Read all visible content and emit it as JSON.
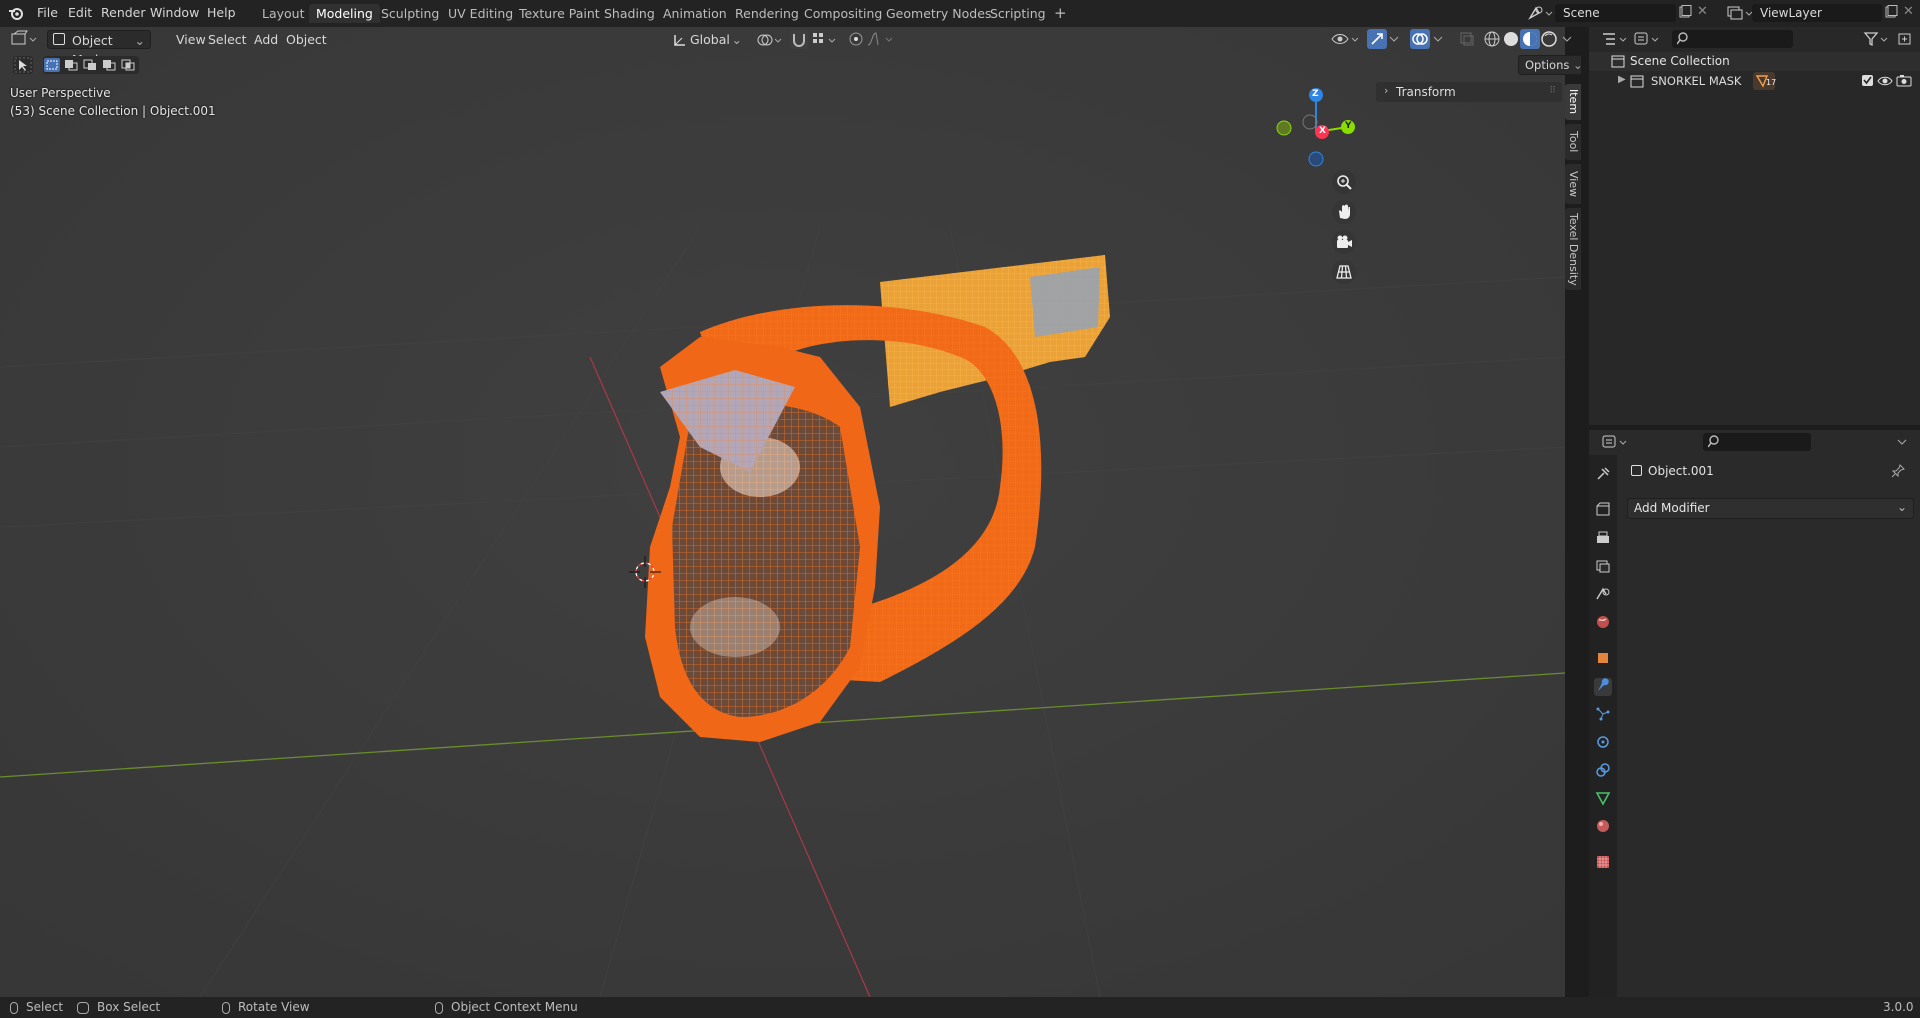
{
  "topbar": {
    "menus": [
      "File",
      "Edit",
      "Render",
      "Window",
      "Help"
    ],
    "workspaces": [
      "Layout",
      "Modeling",
      "Sculpting",
      "UV Editing",
      "Texture Paint",
      "Shading",
      "Animation",
      "Rendering",
      "Compositing",
      "Geometry Nodes",
      "Scripting"
    ],
    "active_workspace": "Modeling",
    "add_workspace": "+",
    "scene_name": "Scene",
    "view_layer": "ViewLayer"
  },
  "viewport_header": {
    "mode": "Object Mode",
    "menus": [
      "View",
      "Select",
      "Add",
      "Object"
    ],
    "orientation": "Global",
    "options": "Options"
  },
  "viewport": {
    "perspective": "User Perspective",
    "collection_info": "(53) Scene Collection | Object.001",
    "transform_panel": "Transform",
    "gizmo_axes": {
      "z": "Z",
      "y": "Y",
      "x": "X"
    },
    "side_tabs": [
      "Item",
      "Tool",
      "View",
      "Texel Density"
    ]
  },
  "outliner": {
    "root": "Scene Collection",
    "items": [
      {
        "name": "SNORKEL MASK",
        "badge": "17"
      }
    ]
  },
  "properties": {
    "object_name": "Object.001",
    "add_modifier": "Add Modifier"
  },
  "statusbar": {
    "select": "Select",
    "box_select": "Box Select",
    "rotate_view": "Rotate View",
    "context_menu": "Object Context Menu",
    "version": "3.0.0"
  },
  "colors": {
    "accent": "#4772b3",
    "selection_orange": "#f26a1b",
    "active_yellow": "#f7a531",
    "axis_x": "#ff3352",
    "axis_y": "#8bdc00",
    "axis_z": "#2f85e4"
  }
}
